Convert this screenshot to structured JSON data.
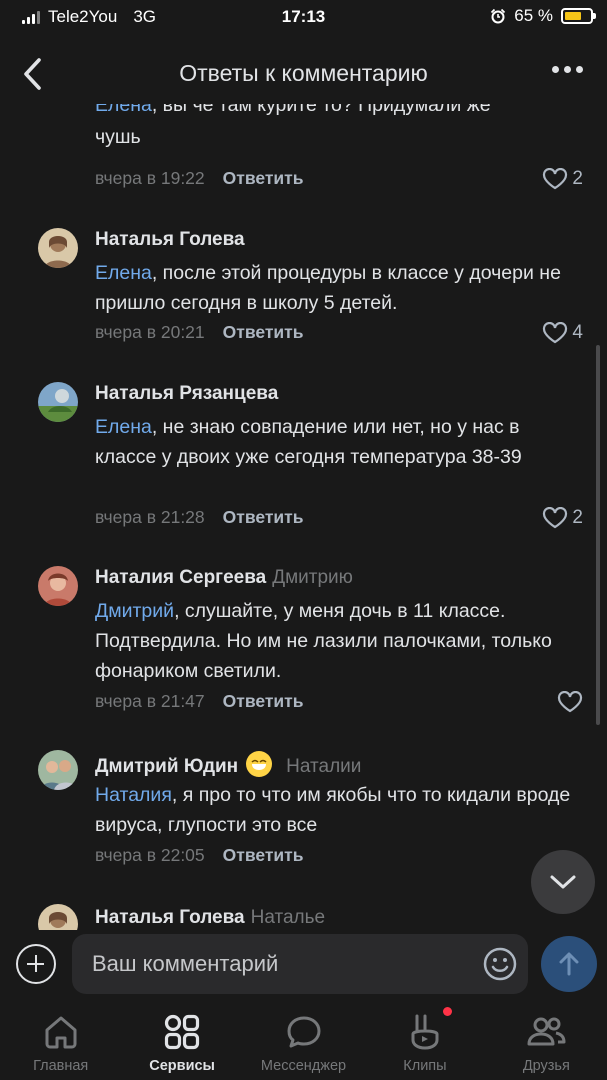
{
  "status_bar": {
    "carrier": "Tele2You",
    "network": "3G",
    "time": "17:13",
    "battery_percent": "65 %",
    "battery_level": 0.65
  },
  "header": {
    "title": "Ответы к комментарию"
  },
  "comments": [
    {
      "author": "",
      "reply_to": "",
      "mention": "Елена",
      "text_line1": ", вы че там курите то? Придумали же",
      "text_rest": "чушь",
      "time": "вчера в 19:22",
      "reply_label": "Ответить",
      "likes": "2"
    },
    {
      "author": "Наталья Голева",
      "reply_to": "",
      "mention": "Елена",
      "text": ", после этой процедуры в классе у дочери не пришло сегодня в школу 5 детей.",
      "time": "вчера в 20:21",
      "reply_label": "Ответить",
      "likes": "4"
    },
    {
      "author": "Наталья Рязанцева",
      "reply_to": "",
      "mention": "Елена",
      "text": ", не знаю совпадение или нет, но у нас в классе у двоих уже сегодня температура 38-39",
      "time": "вчера в 21:28",
      "reply_label": "Ответить",
      "likes": "2"
    },
    {
      "author": "Наталия Сергеева",
      "reply_to": "Дмитрию",
      "mention": "Дмитрий",
      "text": ", слушайте, у меня дочь в 11 классе. Подтвердила. Но им не лазили палочками, только фонариком светили.",
      "time": "вчера в 21:47",
      "reply_label": "Ответить",
      "likes": ""
    },
    {
      "author": "Дмитрий Юдин",
      "reply_to": "Наталии",
      "mention": "Наталия",
      "text": ", я про то что им якобы что то кидали вроде вируса, глупости это все",
      "time": "вчера в 22:05",
      "reply_label": "Ответить",
      "likes": ""
    },
    {
      "author": "Наталья Голева",
      "reply_to": "Наталье",
      "mention": "",
      "text": "",
      "time": "",
      "reply_label": "",
      "likes": ""
    }
  ],
  "composer": {
    "placeholder": "Ваш комментарий"
  },
  "tabs": [
    {
      "label": "Главная",
      "icon": "home-icon",
      "active": false
    },
    {
      "label": "Сервисы",
      "icon": "services-icon",
      "active": true
    },
    {
      "label": "Мессенджер",
      "icon": "messenger-icon",
      "active": false
    },
    {
      "label": "Клипы",
      "icon": "clips-icon",
      "active": false,
      "badge": true
    },
    {
      "label": "Друзья",
      "icon": "friends-icon",
      "active": false
    }
  ],
  "colors": {
    "background": "#191919",
    "text": "#e1e3e6",
    "secondary": "#76787a",
    "link": "#71aaeb",
    "badge": "#ff3347",
    "battery": "#f5c518"
  }
}
